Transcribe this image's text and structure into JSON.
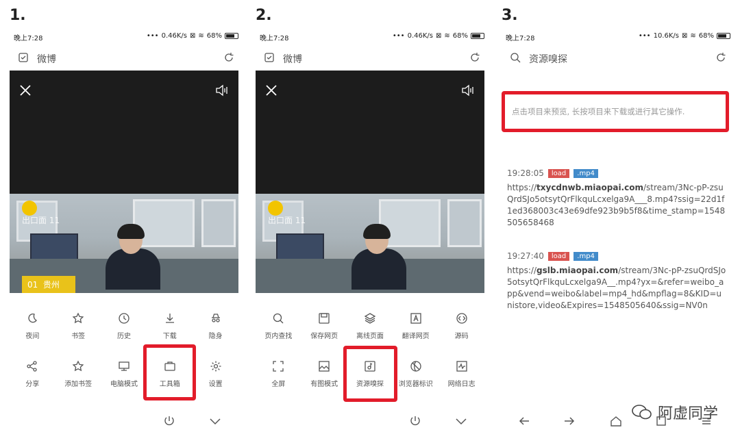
{
  "steps": [
    "1.",
    "2.",
    "3."
  ],
  "status_bar": {
    "time": "晚上7:28",
    "speed_1": "0.46K/s",
    "speed_2": "0.46K/s",
    "speed_3": "10.6K/s",
    "battery": "68%"
  },
  "panel1": {
    "title": "微博"
  },
  "panel2": {
    "title": "微博"
  },
  "panel3": {
    "title": "资源嗅探"
  },
  "video_overlay": {
    "tag": "贵州",
    "tag_num": "01",
    "caption": "出口面 11"
  },
  "menu1": [
    {
      "label": "夜间",
      "icon": "moon-icon"
    },
    {
      "label": "书签",
      "icon": "star-icon"
    },
    {
      "label": "历史",
      "icon": "clock-icon"
    },
    {
      "label": "下载",
      "icon": "download-icon"
    },
    {
      "label": "隐身",
      "icon": "incognito-icon"
    },
    {
      "label": "分享",
      "icon": "share-icon"
    },
    {
      "label": "添加书签",
      "icon": "star-add-icon"
    },
    {
      "label": "电脑模式",
      "icon": "monitor-icon"
    },
    {
      "label": "工具箱",
      "icon": "toolbox-icon"
    },
    {
      "label": "设置",
      "icon": "gear-icon"
    }
  ],
  "menu2": [
    {
      "label": "页内查找",
      "icon": "search-icon"
    },
    {
      "label": "保存网页",
      "icon": "save-icon"
    },
    {
      "label": "离线页面",
      "icon": "layers-icon"
    },
    {
      "label": "翻译网页",
      "icon": "translate-icon"
    },
    {
      "label": "源码",
      "icon": "code-icon"
    },
    {
      "label": "全屏",
      "icon": "fullscreen-icon"
    },
    {
      "label": "有图模式",
      "icon": "image-icon"
    },
    {
      "label": "资源嗅探",
      "icon": "sniff-icon"
    },
    {
      "label": "浏览器标识",
      "icon": "globe-icon"
    },
    {
      "label": "网络日志",
      "icon": "network-log-icon"
    }
  ],
  "sniff": {
    "notice": "点击项目来预览, 长按项目来下载或进行其它操作.",
    "entries": [
      {
        "time": "19:28:05",
        "badge_load": "load",
        "badge_type": ".mp4",
        "url_prefix": "https://",
        "url_host": "txycdnwb.miaopai.com",
        "url_rest": "/stream/3Nc-pP-zsuQrdSJo5otsytQrFlkquLcxelga9A___8.mp4?ssig=22d1f1ed368003c43e69dfe923b9b5f8&time_stamp=1548505658468"
      },
      {
        "time": "19:27:40",
        "badge_load": "load",
        "badge_type": ".mp4",
        "url_prefix": "https://",
        "url_host": "gslb.miaopai.com",
        "url_rest": "/stream/3Nc-pP-zsuQrdSJo5otsytQrFlkquLcxelga9A__.mp4?yx=&refer=weibo_app&vend=weibo&label=mp4_hd&mpflag=8&KID=unistore,video&Expires=1548505640&ssig=NV0n"
      }
    ]
  },
  "watermark": "阿虚同学",
  "colors": {
    "highlight": "#e21c2a",
    "badge_load": "#d9534f",
    "badge_type": "#428bca"
  }
}
